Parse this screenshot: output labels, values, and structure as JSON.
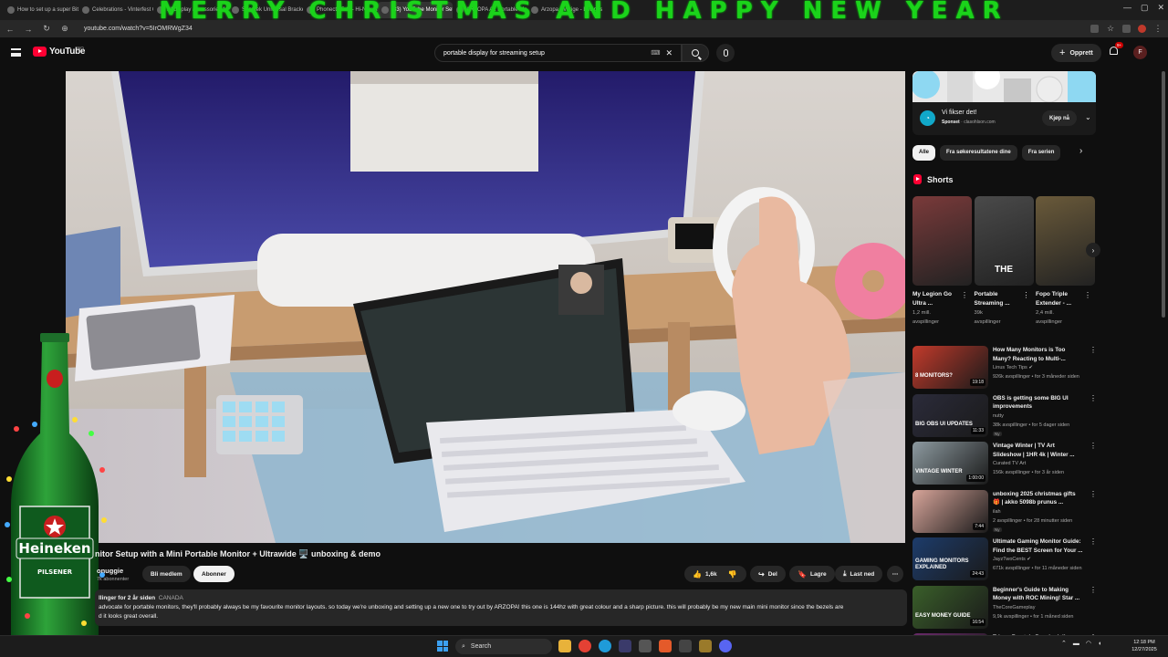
{
  "browser": {
    "banner": "MERRY CHRISTMAS AND HAPPY NEW YEAR",
    "tabs": [
      {
        "label": "How to set up a super Bit cof...",
        "active": false
      },
      {
        "label": "Celebrations - Vinterfest Comp...",
        "active": false
      },
      {
        "label": "all display accessories for ...",
        "active": false
      },
      {
        "label": "Shantek Universal Bracket...",
        "active": false
      },
      {
        "label": "Phonecto 5-G - Hi-Nex Bam...",
        "active": false
      },
      {
        "label": "(33) YouTube Monitor Setup wi...",
        "active": true
      },
      {
        "label": "ARZOPA A1 Portable Mon...",
        "active": false
      },
      {
        "label": "Arzopa Sverige - Lav pris for...",
        "active": false
      }
    ],
    "url": "youtube.com/watch?v=5IrOMRWgZ34"
  },
  "header": {
    "logo_text": "YouTube",
    "region": "NO",
    "search_value": "portable display for streaming setup",
    "create_label": "Opprett",
    "notif_count": "9+",
    "avatar_letter": "F"
  },
  "video": {
    "title": "nitor Setup with a Mini Portable Monitor + Ultrawide 🖥️ unboxing & demo",
    "channel": "onuggie",
    "subscribers": "7k abonnenter",
    "member_label": "Bli medlem",
    "subscribe_label": "Abonner",
    "likes": "1,6k",
    "share_label": "Del",
    "save_label": "Lagre",
    "download_label": "Last ned",
    "desc_views": "llinger for 2 år siden",
    "desc_country": "CANADA",
    "desc_text_1": "advocate for portable monitors, they'll probably always be my favourite monitor layouts. so today we're unboxing and setting up a new one to try out by ARZOPA! this one is 144hz with great colour and a sharp picture. this will probably be my new main mini monitor since the bezels are",
    "desc_text_2": "d it looks great overall.",
    "bottle_label": "Heineken",
    "bottle_sub": "PILSENER"
  },
  "ad": {
    "title": "Vi fikser det!",
    "sponsored": "Sponset",
    "domain": "clasohlson.com",
    "buy_label": "Kjøp nå",
    "accent": "#11a8c9"
  },
  "chips": [
    "Alle",
    "Fra søkeresultatene dine",
    "Fra serien"
  ],
  "shorts": {
    "heading": "Shorts",
    "items": [
      {
        "title": "My Legion Go Ultra ...",
        "views": "1,2 mill.",
        "views2": "avspillinger"
      },
      {
        "title": "Portable Streaming ...",
        "views": "39k",
        "views2": "avspillinger"
      },
      {
        "title": "Fopo Triple Extender - ...",
        "views": "2,4 mill.",
        "views2": "avspillinger"
      }
    ],
    "thumb_text": "THE"
  },
  "recommended": [
    {
      "title": "How Many Monitors is Too Many? Reacting to Multi-...",
      "channel": "Linus Tech Tips ✔",
      "meta": "926k avspillinger • for 3 måneder siden",
      "duration": "19:18",
      "badge": "",
      "thumb_text": "8 MONITORS?",
      "color": "#c23a2b"
    },
    {
      "title": "OBS is getting some BIG UI improvements",
      "channel": "nutty",
      "meta": "38k avspillinger • for 5 dager siden",
      "duration": "11:33",
      "badge": "Ny",
      "thumb_text": "BIG OBS UI UPDATES",
      "color": "#2b2b3a"
    },
    {
      "title": "Vintage Winter | TV Art Slideshow | 1HR 4k | Winter ...",
      "channel": "Curated TV Art",
      "meta": "156k avspillinger • for 3 år siden",
      "duration": "1:00:00",
      "badge": "",
      "thumb_text": "VINTAGE WINTER",
      "color": "#8d9aa0"
    },
    {
      "title": "unboxing 2025 christmas gifts 🎁 | akko 5098b prunus ...",
      "channel": "ilah",
      "meta": "2 avspillinger • for 28 minutter siden",
      "duration": "7:44",
      "badge": "Ny",
      "thumb_text": "",
      "color": "#d8a59a"
    },
    {
      "title": "Ultimate Gaming Monitor Guide: Find the BEST Screen for Your ...",
      "channel": "JayzTwoCents ✔",
      "meta": "671k avspillinger • for 11 måneder siden",
      "duration": "24:43",
      "badge": "",
      "thumb_text": "GAMING MONITORS EXPLAINED",
      "color": "#1d3c6b"
    },
    {
      "title": "Beginner's Guide to Making Money with ROC Mining! Star ...",
      "channel": "TheCoreGameplay",
      "meta": "9,9k avspillinger • for 1 måned siden",
      "duration": "16:54",
      "badge": "",
      "thumb_text": "EASY MONEY GUIDE",
      "color": "#3a5f2a"
    },
    {
      "title": "Trippy Fractals Psychedelic...",
      "channel": "",
      "meta": "",
      "duration": "",
      "badge": "",
      "thumb_text": "",
      "color": "#6a2a6a"
    }
  ],
  "taskbar": {
    "search_label": "Search",
    "time": "12:18 PM",
    "date": "12/27/2025"
  }
}
